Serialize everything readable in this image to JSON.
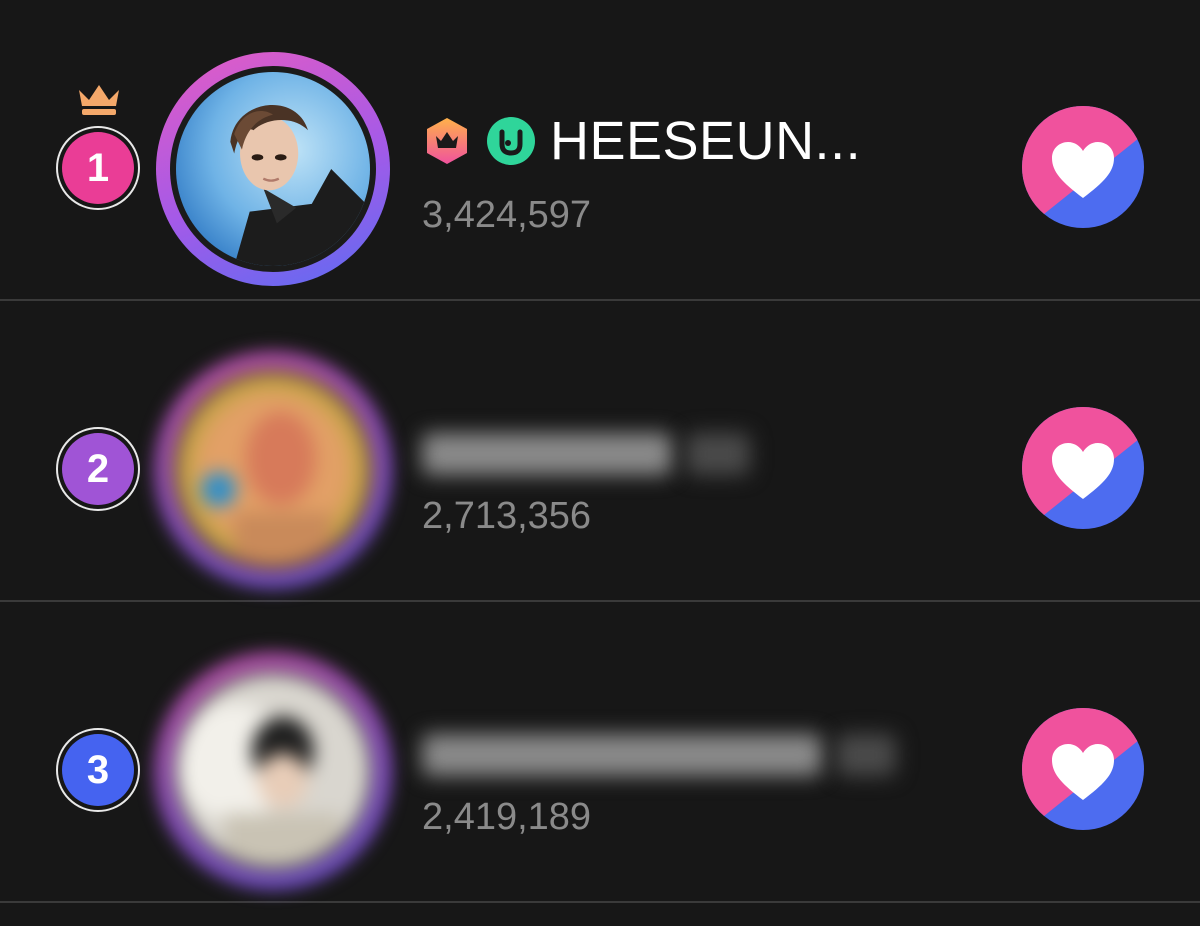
{
  "ranking": {
    "entries": [
      {
        "rank": "1",
        "name": "HEESEUN...",
        "score": "3,424,597",
        "name_hidden": false,
        "badges": [
          "crown-hexagon-icon",
          "u-circle-icon"
        ],
        "rank_color": "#ea3d96",
        "has_crown": true
      },
      {
        "rank": "2",
        "name": "",
        "score": "2,713,356",
        "name_hidden": true,
        "rank_color": "#a054d6",
        "has_crown": false
      },
      {
        "rank": "3",
        "name": "",
        "score": "2,419,189",
        "name_hidden": true,
        "rank_color": "#4563f0",
        "has_crown": false
      }
    ],
    "vote_icon": "heart-vote-icon",
    "colors": {
      "background": "#171717",
      "pink": "#f0529d",
      "blue": "#4d6cf0",
      "score": "#8a8a8a"
    }
  }
}
